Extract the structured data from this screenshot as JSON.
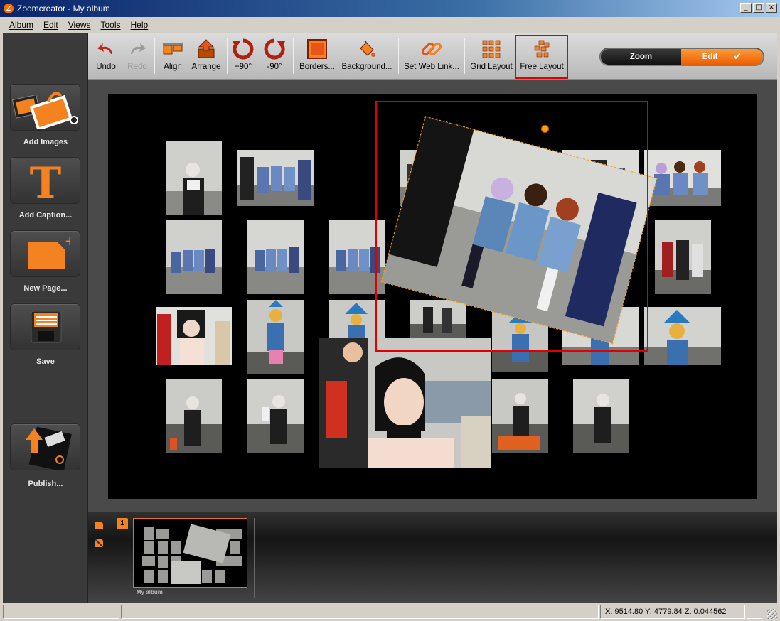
{
  "window": {
    "title": "Zoomcreator - My album",
    "app_icon": "Z"
  },
  "menu": [
    "Album",
    "Edit",
    "Views",
    "Tools",
    "Help"
  ],
  "toolbar": {
    "undo": "Undo",
    "redo": "Redo",
    "align": "Align",
    "arrange": "Arrange",
    "rotate_cw": "+90°",
    "rotate_ccw": "-90°",
    "borders": "Borders...",
    "background": "Background...",
    "web_link": "Set Web Link...",
    "grid_layout": "Grid Layout",
    "free_layout": "Free Layout"
  },
  "mode": {
    "zoom": "Zoom",
    "edit": "Edit",
    "selected": "Edit"
  },
  "sidebar": {
    "add_images": "Add Images",
    "add_caption": "Add Caption...",
    "new_page": "New Page...",
    "save": "Save",
    "publish": "Publish..."
  },
  "pages": {
    "page_number": "1",
    "album_label": "My album"
  },
  "status": {
    "coords": "X: 9514.80 Y: 4779.84 Z: 0.044562"
  },
  "colors": {
    "accent": "#f58220",
    "selection": "#e00000",
    "canvas": "#000000"
  }
}
